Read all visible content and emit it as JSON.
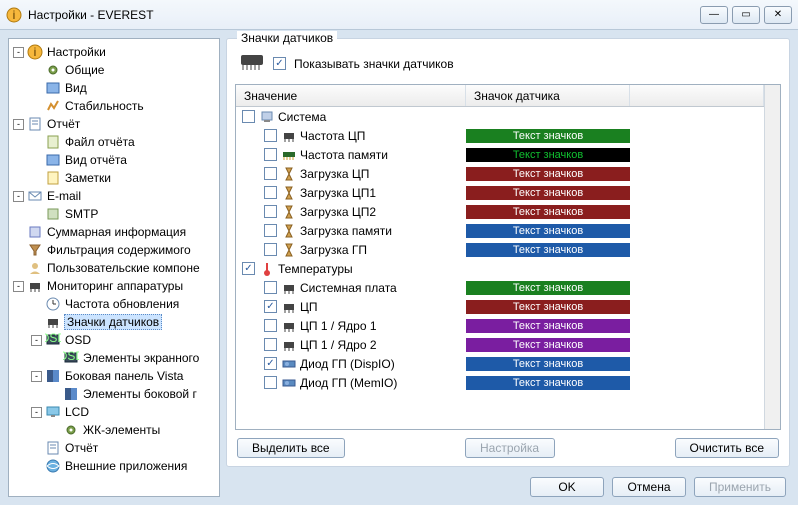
{
  "window": {
    "title": "Настройки - EVEREST"
  },
  "tree": [
    {
      "d": 0,
      "exp": "-",
      "icon": "info",
      "label": "Настройки"
    },
    {
      "d": 1,
      "exp": " ",
      "icon": "gear",
      "label": "Общие"
    },
    {
      "d": 1,
      "exp": " ",
      "icon": "view",
      "label": "Вид"
    },
    {
      "d": 1,
      "exp": " ",
      "icon": "stab",
      "label": "Стабильность"
    },
    {
      "d": 0,
      "exp": "-",
      "icon": "report",
      "label": "Отчёт"
    },
    {
      "d": 1,
      "exp": " ",
      "icon": "file",
      "label": "Файл отчёта"
    },
    {
      "d": 1,
      "exp": " ",
      "icon": "view",
      "label": "Вид отчёта"
    },
    {
      "d": 1,
      "exp": " ",
      "icon": "note",
      "label": "Заметки"
    },
    {
      "d": 0,
      "exp": "-",
      "icon": "mail",
      "label": "E-mail"
    },
    {
      "d": 1,
      "exp": " ",
      "icon": "srv",
      "label": "SMTP"
    },
    {
      "d": 0,
      "exp": " ",
      "icon": "sum",
      "label": "Суммарная информация"
    },
    {
      "d": 0,
      "exp": " ",
      "icon": "filter",
      "label": "Фильтрация содержимого"
    },
    {
      "d": 0,
      "exp": " ",
      "icon": "user",
      "label": "Пользовательские компоне"
    },
    {
      "d": 0,
      "exp": "-",
      "icon": "chip",
      "label": "Мониторинг аппаратуры"
    },
    {
      "d": 1,
      "exp": " ",
      "icon": "clock",
      "label": "Частота обновления"
    },
    {
      "d": 1,
      "exp": " ",
      "icon": "chip",
      "label": "Значки датчиков",
      "selected": true
    },
    {
      "d": 1,
      "exp": "-",
      "icon": "osd",
      "label": "OSD"
    },
    {
      "d": 2,
      "exp": " ",
      "icon": "osd",
      "label": "Элементы экранного"
    },
    {
      "d": 1,
      "exp": "-",
      "icon": "vista",
      "label": "Боковая панель Vista"
    },
    {
      "d": 2,
      "exp": " ",
      "icon": "vista",
      "label": "Элементы боковой г"
    },
    {
      "d": 1,
      "exp": "-",
      "icon": "lcd",
      "label": "LCD"
    },
    {
      "d": 2,
      "exp": " ",
      "icon": "gear",
      "label": "ЖК-элементы"
    },
    {
      "d": 1,
      "exp": " ",
      "icon": "report",
      "label": "Отчёт"
    },
    {
      "d": 1,
      "exp": " ",
      "icon": "ext",
      "label": "Внешние приложения"
    }
  ],
  "group": {
    "title": "Значки датчиков",
    "show_label": "Показывать значки датчиков",
    "table": {
      "col_value": "Значение",
      "col_sensor": "Значок датчика"
    }
  },
  "badge_text": "Текст значков",
  "rows": [
    {
      "indent": 0,
      "checked": false,
      "icon": "pc",
      "label": "Система",
      "badge": null
    },
    {
      "indent": 1,
      "checked": false,
      "icon": "chip",
      "label": "Частота ЦП",
      "badge": "#1a8020"
    },
    {
      "indent": 1,
      "checked": false,
      "icon": "mem",
      "label": "Частота памяти",
      "badge": "#000000",
      "text": "#10c030"
    },
    {
      "indent": 1,
      "checked": false,
      "icon": "hour",
      "label": "Загрузка ЦП",
      "badge": "#8a1e1e"
    },
    {
      "indent": 1,
      "checked": false,
      "icon": "hour",
      "label": "Загрузка ЦП1",
      "badge": "#8a1e1e"
    },
    {
      "indent": 1,
      "checked": false,
      "icon": "hour",
      "label": "Загрузка ЦП2",
      "badge": "#8a1e1e"
    },
    {
      "indent": 1,
      "checked": false,
      "icon": "hour",
      "label": "Загрузка памяти",
      "badge": "#1e5aa8"
    },
    {
      "indent": 1,
      "checked": false,
      "icon": "hour",
      "label": "Загрузка ГП",
      "badge": "#1e5aa8"
    },
    {
      "indent": 0,
      "checked": true,
      "icon": "therm",
      "label": "Температуры",
      "badge": null
    },
    {
      "indent": 1,
      "checked": false,
      "icon": "chip",
      "label": "Системная плата",
      "badge": "#1a8020"
    },
    {
      "indent": 1,
      "checked": true,
      "icon": "chip",
      "label": "ЦП",
      "badge": "#8a1e1e"
    },
    {
      "indent": 1,
      "checked": false,
      "icon": "chip",
      "label": "ЦП 1 / Ядро 1",
      "badge": "#7a1ea0"
    },
    {
      "indent": 1,
      "checked": false,
      "icon": "chip",
      "label": "ЦП 1 / Ядро 2",
      "badge": "#7a1ea0"
    },
    {
      "indent": 1,
      "checked": true,
      "icon": "gpu",
      "label": "Диод ГП (DispIO)",
      "badge": "#1e5aa8"
    },
    {
      "indent": 1,
      "checked": false,
      "icon": "gpu",
      "label": "Диод ГП (MemIO)",
      "badge": "#1e5aa8"
    }
  ],
  "buttons": {
    "select_all": "Выделить все",
    "configure": "Настройка",
    "clear_all": "Очистить все",
    "ok": "OK",
    "cancel": "Отмена",
    "apply": "Применить"
  }
}
